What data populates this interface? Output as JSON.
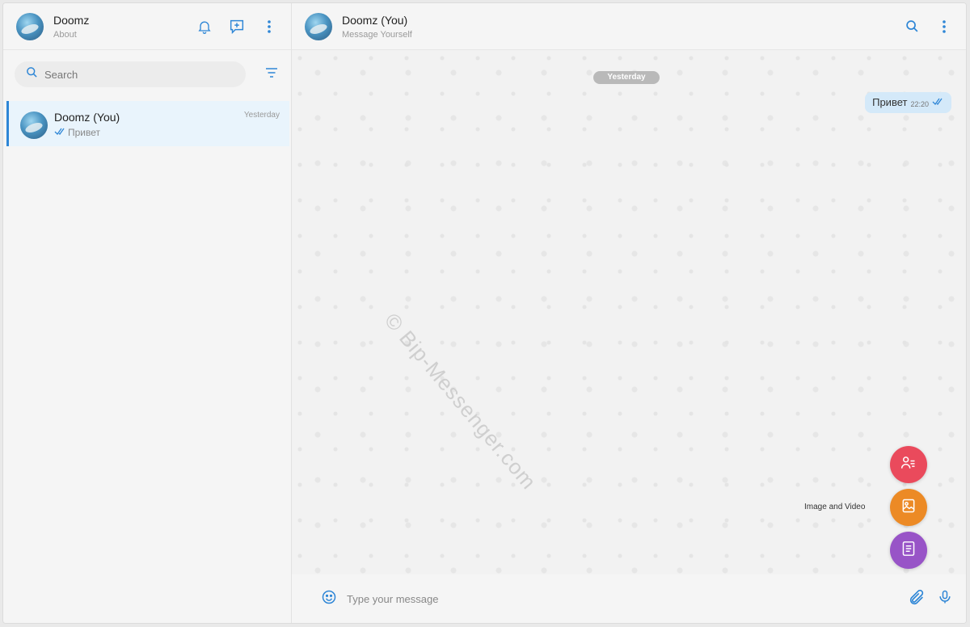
{
  "sidebar": {
    "profile": {
      "name": "Doomz",
      "about": "About"
    },
    "search": {
      "placeholder": "Search"
    },
    "chats": [
      {
        "name": "Doomz (You)",
        "last_message": "Привет",
        "time": "Yesterday"
      }
    ]
  },
  "chat": {
    "title": "Doomz (You)",
    "subtitle": "Message Yourself",
    "date_divider": "Yesterday",
    "messages": [
      {
        "text": "Привет",
        "time": "22:20",
        "status": "read"
      }
    ],
    "watermark": "© Bip-Messenger.com",
    "attach_menu": {
      "hover_label": "Image and Video"
    },
    "input": {
      "placeholder": "Type your message"
    }
  },
  "colors": {
    "accent": "#2e86d6",
    "fab_contact": "#ea4a5c",
    "fab_media": "#ec8a25",
    "fab_document": "#9854c7",
    "bubble": "#d4e9f9"
  },
  "icons": [
    "bell-icon",
    "new-chat-icon",
    "more-icon",
    "search-icon",
    "filter-icon",
    "double-check-icon",
    "emoji-icon",
    "paperclip-icon",
    "mic-icon",
    "contact-icon",
    "image-icon",
    "document-icon",
    "cursor-hand-icon"
  ]
}
